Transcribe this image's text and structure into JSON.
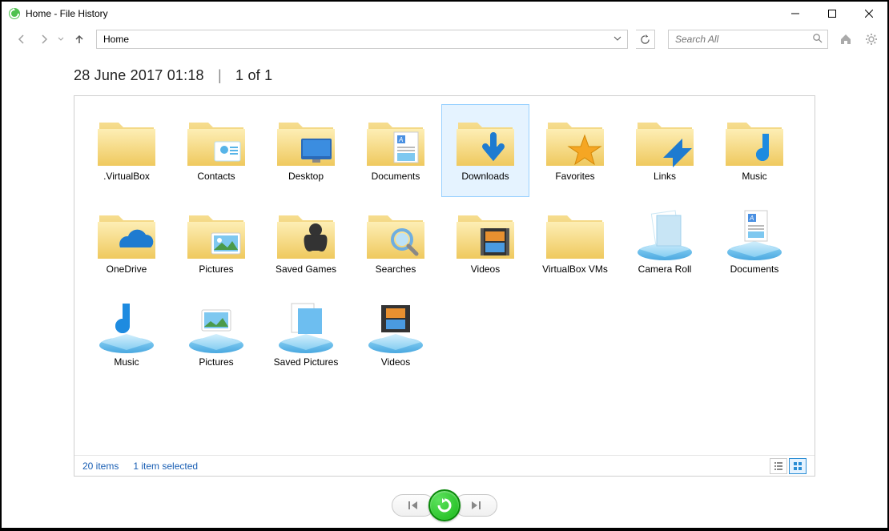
{
  "title": "Home - File History",
  "address": "Home",
  "search_placeholder": "Search All",
  "header": {
    "date": "28 June 2017 01:18",
    "pos": "1 of 1"
  },
  "status": {
    "count": "20 items",
    "selected": "1 item selected"
  },
  "items": [
    {
      "name": ".VirtualBox",
      "type": "folder",
      "selected": false
    },
    {
      "name": "Contacts",
      "type": "folder-contact",
      "selected": false
    },
    {
      "name": "Desktop",
      "type": "folder-desktop",
      "selected": false
    },
    {
      "name": "Documents",
      "type": "folder-documents",
      "selected": false
    },
    {
      "name": "Downloads",
      "type": "folder-downloads",
      "selected": true
    },
    {
      "name": "Favorites",
      "type": "folder-favorites",
      "selected": false
    },
    {
      "name": "Links",
      "type": "folder-links",
      "selected": false
    },
    {
      "name": "Music",
      "type": "folder-music",
      "selected": false
    },
    {
      "name": "OneDrive",
      "type": "folder-onedrive",
      "selected": false
    },
    {
      "name": "Pictures",
      "type": "folder-pictures",
      "selected": false
    },
    {
      "name": "Saved Games",
      "type": "folder-games",
      "selected": false
    },
    {
      "name": "Searches",
      "type": "folder-search",
      "selected": false
    },
    {
      "name": "Videos",
      "type": "folder-videos",
      "selected": false
    },
    {
      "name": "VirtualBox VMs",
      "type": "folder",
      "selected": false
    },
    {
      "name": "Camera Roll",
      "type": "lib-camera",
      "selected": false
    },
    {
      "name": "Documents",
      "type": "lib-documents",
      "selected": false
    },
    {
      "name": "Music",
      "type": "lib-music",
      "selected": false
    },
    {
      "name": "Pictures",
      "type": "lib-pictures",
      "selected": false
    },
    {
      "name": "Saved Pictures",
      "type": "lib-saved",
      "selected": false
    },
    {
      "name": "Videos",
      "type": "lib-videos",
      "selected": false
    }
  ]
}
